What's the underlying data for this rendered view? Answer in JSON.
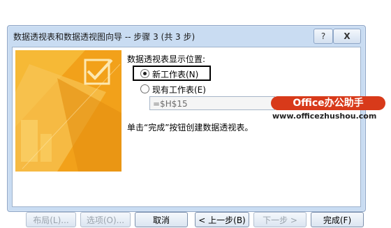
{
  "dialog": {
    "title": "数据透视表和数据透视图向导 -- 步骤 3 (共 3 步)",
    "help_glyph": "?",
    "close_glyph": "X"
  },
  "location": {
    "prompt": "数据透视表显示位置:",
    "option_new": "新工作表(N)",
    "option_existing": "现有工作表(E)",
    "selected": "new",
    "reference_value": "=$H$15"
  },
  "hint": "单击“完成”按钮创建数据透视表。",
  "watermark": {
    "brand": "Office办公助手",
    "url": "www.officezhushou.com"
  },
  "buttons": {
    "layout": "布局(L)...",
    "options": "选项(O)...",
    "cancel": "取消",
    "back": "< 上一步(B)",
    "next": "下一步 >",
    "finish": "完成(F)"
  },
  "colors": {
    "art_orange": "#f2a11a",
    "art_light": "#fbd36b",
    "watermark_red": "#d83a1a"
  }
}
